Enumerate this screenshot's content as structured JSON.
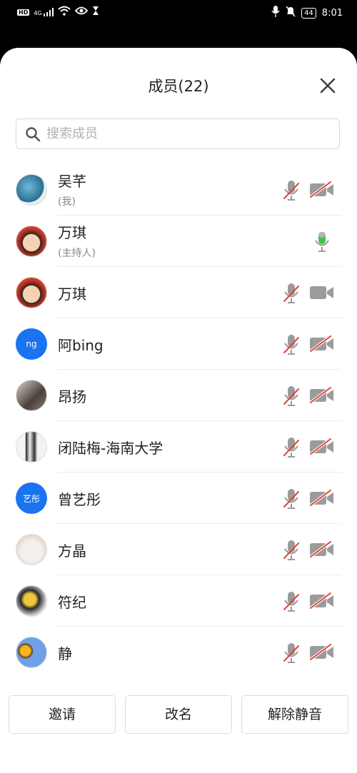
{
  "status_bar": {
    "left_icons": [
      "hd-icon",
      "signal-4g-icon",
      "wifi-icon",
      "eye-icon",
      "hourglass-icon"
    ],
    "left_label": "HD",
    "network_label": "4G",
    "battery": "44",
    "time": "8:01"
  },
  "header": {
    "title": "成员(22)"
  },
  "search": {
    "placeholder": "搜索成员",
    "value": ""
  },
  "members": [
    {
      "name": "吴芊",
      "sub": "(我)",
      "avatar": "photo-wave",
      "mic": "muted",
      "camera": "off"
    },
    {
      "name": "万琪",
      "sub": "(主持人)",
      "avatar": "photo-child",
      "mic": "speaking-green",
      "camera": "none"
    },
    {
      "name": "万琪",
      "sub": "",
      "avatar": "photo-child",
      "mic": "muted",
      "camera": "on"
    },
    {
      "name": "阿bing",
      "sub": "",
      "avatar": "initials",
      "avatar_text": "ng",
      "mic": "muted",
      "camera": "off"
    },
    {
      "name": "昂扬",
      "sub": "",
      "avatar": "photo-person",
      "mic": "muted",
      "camera": "off"
    },
    {
      "name": "闭陆梅-海南大学",
      "sub": "",
      "avatar": "photo-sketch",
      "mic": "muted",
      "camera": "off"
    },
    {
      "name": "曾艺彤",
      "sub": "",
      "avatar": "initials",
      "avatar_text": "艺彤",
      "mic": "muted",
      "camera": "off"
    },
    {
      "name": "方晶",
      "sub": "",
      "avatar": "photo-cat",
      "mic": "muted",
      "camera": "off"
    },
    {
      "name": "符纪",
      "sub": "",
      "avatar": "photo-flower-person",
      "mic": "muted",
      "camera": "off"
    },
    {
      "name": "静",
      "sub": "",
      "avatar": "photo-sunflower",
      "mic": "muted",
      "camera": "off"
    }
  ],
  "buttons": {
    "invite": "邀请",
    "rename": "改名",
    "unmute": "解除静音"
  },
  "colors": {
    "accent_blue": "#1a73f0",
    "mute_red": "#e0453a",
    "icon_gray": "#9b9b9b",
    "mic_green": "#3cc44c"
  }
}
